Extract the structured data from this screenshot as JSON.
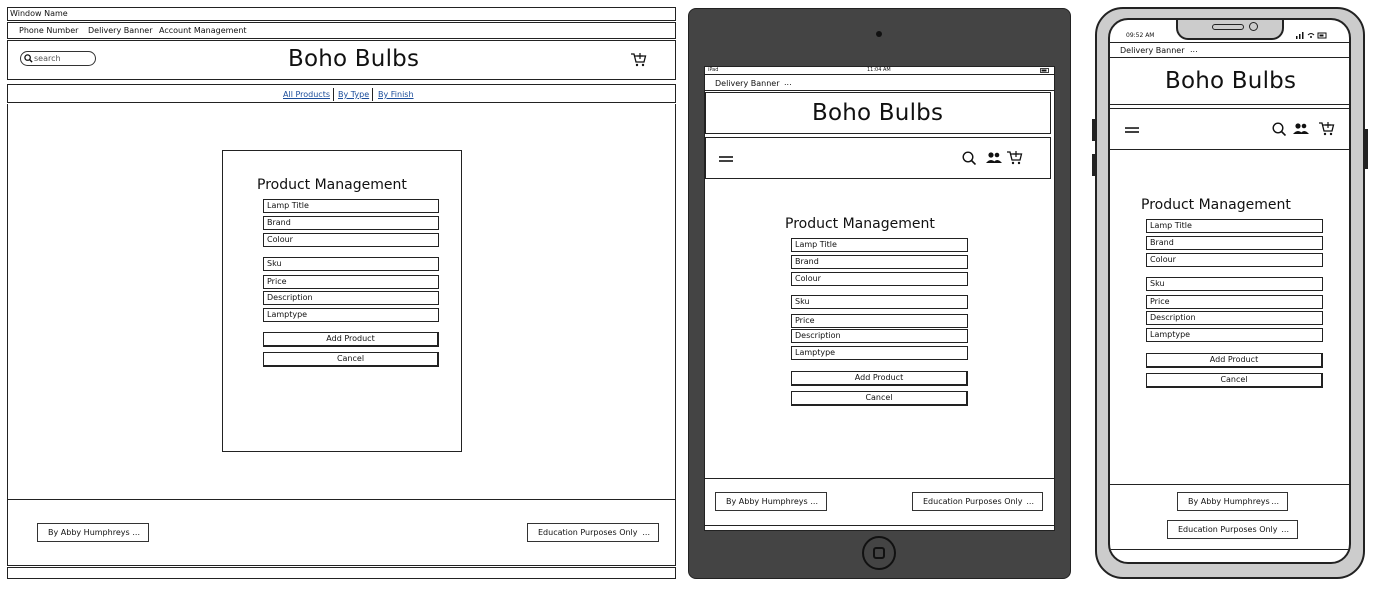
{
  "desktop": {
    "window_name": "Window Name",
    "top_links": [
      "Phone Number",
      "Delivery Banner",
      "Account Management"
    ],
    "search_placeholder": "search",
    "brand": "Boho Bulbs",
    "nav": [
      "All Products",
      "By Type",
      "By Finish"
    ],
    "form": {
      "title": "Product Management",
      "fields": [
        "Lamp Title",
        "Brand",
        "Colour",
        "Sku",
        "Price",
        "Description",
        "Lamptype"
      ],
      "add_label": "Add Product",
      "cancel_label": "Cancel"
    },
    "footer_left": "By Abby Humphreys",
    "footer_right": "Education Purposes Only",
    "ellipsis": "..."
  },
  "tablet": {
    "status_left": "iPad",
    "status_time": "11:04 AM",
    "delivery_banner": "Delivery Banner",
    "brand": "Boho Bulbs",
    "form": {
      "title": "Product Management",
      "fields": [
        "Lamp Title",
        "Brand",
        "Colour",
        "Sku",
        "Price",
        "Description",
        "Lamptype"
      ],
      "add_label": "Add Product",
      "cancel_label": "Cancel"
    },
    "footer_left": "By Abby Humphreys",
    "footer_right": "Education Purposes Only",
    "ellipsis": "..."
  },
  "phone": {
    "status_time": "09:52 AM",
    "delivery_banner": "Delivery Banner",
    "brand": "Boho Bulbs",
    "form": {
      "title": "Product Management",
      "fields": [
        "Lamp Title",
        "Brand",
        "Colour",
        "Sku",
        "Price",
        "Description",
        "Lamptype"
      ],
      "add_label": "Add Product",
      "cancel_label": "Cancel"
    },
    "footer_left": "By Abby Humphreys",
    "footer_right": "Education Purposes Only",
    "ellipsis": "..."
  },
  "icons": [
    "search-icon",
    "cart-icon",
    "menu-icon",
    "user-icon",
    "wifi-icon",
    "battery-icon",
    "home-button-icon",
    "camera-icon"
  ]
}
